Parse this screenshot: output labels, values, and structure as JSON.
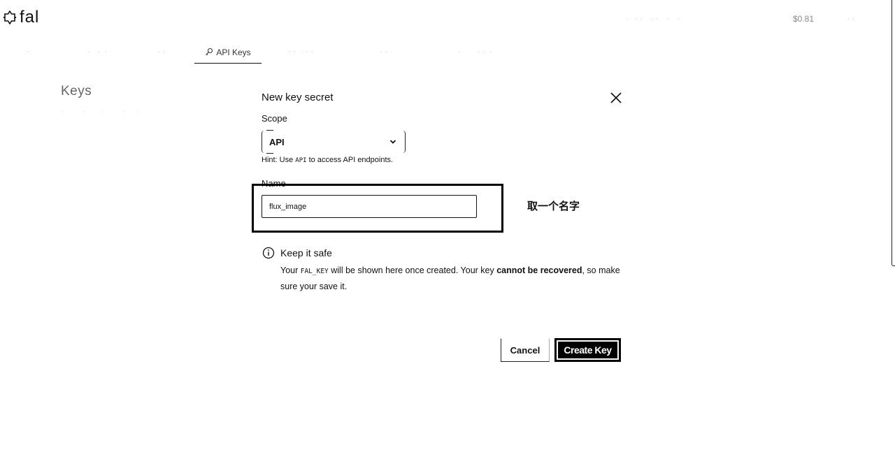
{
  "header": {
    "logo_text": "fal",
    "balance": "$0.81",
    "logo_icon": "fal-logo-icon"
  },
  "tabs": {
    "active_label": "API Keys",
    "active_icon": "key-icon"
  },
  "page": {
    "title": "Keys"
  },
  "modal": {
    "title": "New key secret",
    "close_icon": "close-icon",
    "scope_label": "Scope",
    "scope_value": "API",
    "scope_hint_prefix": "Hint: Use ",
    "scope_hint_code": "API",
    "scope_hint_suffix": " to access API endpoints.",
    "name_label": "Name",
    "name_value": "flux_image",
    "safe_title": "Keep it safe",
    "safe_text_1": "Your ",
    "safe_text_code": "FAL_KEY",
    "safe_text_2": " will be shown here once created. Your key ",
    "safe_text_bold": "cannot be recovered",
    "safe_text_3": ", so make sure your save it.",
    "cancel_label": "Cancel",
    "create_label": "Create Key"
  },
  "annotation": {
    "text": "取一个名字"
  }
}
